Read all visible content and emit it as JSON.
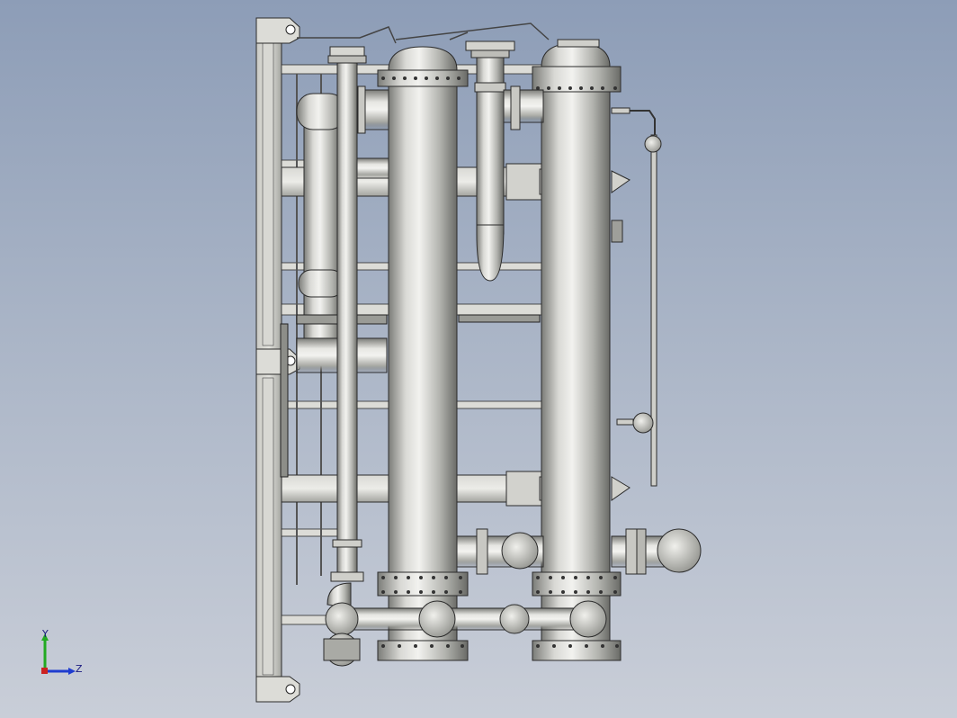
{
  "viewport": {
    "background_top": "#8d9db7",
    "background_bottom": "#c9ced8"
  },
  "model": {
    "description_name": "heat-exchanger-assembly",
    "metal_light": "#e9e9e6",
    "metal_mid": "#b9b9b4",
    "metal_dark": "#6f706c",
    "outline": "#2b2b2b"
  },
  "triad": {
    "y_label": "Y",
    "z_label": "Z",
    "y_color": "#22aa22",
    "z_color": "#1f3ccf",
    "x_color": "#cc2222"
  }
}
